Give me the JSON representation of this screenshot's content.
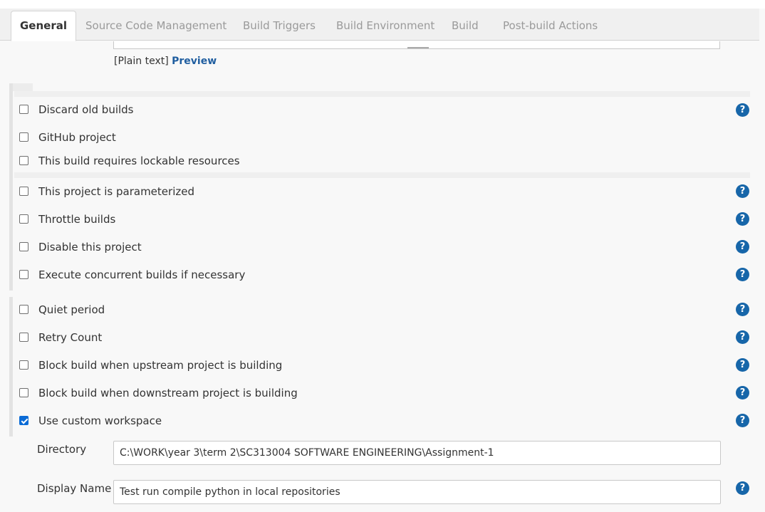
{
  "tabs": [
    {
      "label": "General"
    },
    {
      "label": "Source Code Management"
    },
    {
      "label": "Build Triggers"
    },
    {
      "label": "Build Environment"
    },
    {
      "label": "Build"
    },
    {
      "label": "Post-build Actions"
    }
  ],
  "description": {
    "plain_text": "[Plain text]",
    "preview": "Preview"
  },
  "options": [
    {
      "label": "Discard old builds",
      "checked": false
    },
    {
      "label": "GitHub project",
      "checked": false
    },
    {
      "label": "This build requires lockable resources",
      "checked": false
    },
    {
      "label": "This project is parameterized",
      "checked": false
    },
    {
      "label": "Throttle builds",
      "checked": false
    },
    {
      "label": "Disable this project",
      "checked": false
    },
    {
      "label": "Execute concurrent builds if necessary",
      "checked": false
    },
    {
      "label": "Quiet period",
      "checked": false
    },
    {
      "label": "Retry Count",
      "checked": false
    },
    {
      "label": "Block build when upstream project is building",
      "checked": false
    },
    {
      "label": "Block build when downstream project is building",
      "checked": false
    },
    {
      "label": "Use custom workspace",
      "checked": true
    }
  ],
  "workspace": {
    "directory_label": "Directory",
    "directory_value": "C:\\WORK\\year 3\\term 2\\SC313004 SOFTWARE ENGINEERING\\Assignment-1",
    "display_name_label": "Display Name",
    "display_name_value": "Test run compile python in local repositories"
  },
  "help_icon_glyph": "?",
  "colors": {
    "accent_link": "#205ea0",
    "help_icon": "#1766a9",
    "checkbox_checked": "#0b6bd6"
  }
}
